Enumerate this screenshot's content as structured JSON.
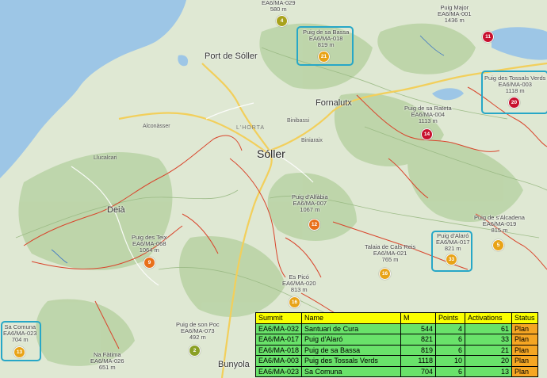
{
  "map": {
    "towns": [
      {
        "name": "Port de Sóller",
        "id": "port-de-soller"
      },
      {
        "name": "Fornalutx",
        "id": "fornalutx"
      },
      {
        "name": "Sóller",
        "id": "soller"
      },
      {
        "name": "Deià",
        "id": "deia"
      },
      {
        "name": "Bunyola",
        "id": "bunyola"
      }
    ],
    "small_places": [
      {
        "name": "Alconàsser",
        "id": "alconasser"
      },
      {
        "name": "Llucalcari",
        "id": "llucalcari"
      },
      {
        "name": "Biniaraix",
        "id": "biniaraix"
      },
      {
        "name": "Binibassi",
        "id": "binibassi"
      },
      {
        "name": "L'HORTA",
        "id": "lhorta"
      }
    ],
    "peaks": [
      {
        "id": "ma-029",
        "lines": [
          "EA6/MA-029",
          "580 m"
        ],
        "marker": "4",
        "color": "#a8a21c"
      },
      {
        "id": "puig-major",
        "lines": [
          "Puig Major",
          "EA6/MA-001",
          "1436 m"
        ],
        "marker": "11",
        "color": "#c8102e"
      },
      {
        "id": "puig-de-sa-bassa",
        "lines": [
          "Puig de sa Bassa",
          "EA6/MA-018",
          "819 m"
        ],
        "marker": "21",
        "color": "#e8a317"
      },
      {
        "id": "puig-des-tossals-verds",
        "lines": [
          "Puig des Tossals Verds",
          "EA6/MA-003",
          "1118 m"
        ],
        "marker": "20",
        "color": "#c8102e"
      },
      {
        "id": "puig-de-sa-rateta",
        "lines": [
          "Puig de sa Rateta",
          "EA6/MA-004",
          "1113 m"
        ],
        "marker": "14",
        "color": "#c8102e"
      },
      {
        "id": "puig-dalfabia",
        "lines": [
          "Puig d'Alfàbia",
          "EA6/MA-007",
          "1067 m"
        ],
        "marker": "12",
        "color": "#e8701a"
      },
      {
        "id": "puig-de-s-alcadena",
        "lines": [
          "Puig de s'Alcadena",
          "EA6/MA-019",
          "815 m"
        ],
        "marker": "5",
        "color": "#e8a317"
      },
      {
        "id": "puig-des-teix",
        "lines": [
          "Puig des Teix",
          "EA6/MA-068",
          "1064 m"
        ],
        "marker": "9",
        "color": "#e8701a"
      },
      {
        "id": "talaia-de-cals-reis",
        "lines": [
          "Talaia de Cals Reis",
          "EA6/MA-021",
          "765 m"
        ],
        "marker": "16",
        "color": "#e8a317"
      },
      {
        "id": "puig-dalaro",
        "lines": [
          "Puig d'Alaró",
          "EA6/MA-017",
          "821 m"
        ],
        "marker": "33",
        "color": "#e8a317"
      },
      {
        "id": "es-pico",
        "lines": [
          "Es Picó",
          "EA6/MA-020",
          "813 m"
        ],
        "marker": "16",
        "color": "#e8a317"
      },
      {
        "id": "puig-de-son-poc",
        "lines": [
          "Puig de son Poc",
          "EA6/MA-073",
          "492 m"
        ],
        "marker": "2",
        "color": "#8aa024"
      },
      {
        "id": "sa-comuna",
        "lines": [
          "Sa Comuna",
          "EA6/MA-023",
          "704 m"
        ],
        "marker": "13",
        "color": "#e8a317"
      },
      {
        "id": "na-fatima",
        "lines": [
          "Na Fàtima",
          "EA6/MA-026",
          "651 m"
        ],
        "marker": "",
        "color": ""
      }
    ]
  },
  "table": {
    "headers": [
      "Summit",
      "Name",
      "M",
      "Points",
      "Activations",
      "Status"
    ],
    "rows": [
      [
        "EA6/MA-032",
        "Santuari de Cura",
        "544",
        "4",
        "61",
        "Plan"
      ],
      [
        "EA6/MA-017",
        "Puig d'Alaró",
        "821",
        "6",
        "33",
        "Plan"
      ],
      [
        "EA6/MA-018",
        "Puig de sa Bassa",
        "819",
        "6",
        "21",
        "Plan"
      ],
      [
        "EA6/MA-003",
        "Puig des Tossals Verds",
        "1118",
        "10",
        "20",
        "Plan"
      ],
      [
        "EA6/MA-023",
        "Sa Comuna",
        "704",
        "6",
        "13",
        "Plan"
      ]
    ]
  },
  "colors": {
    "sea": "#9dc6e6",
    "land": "#dfe8d3",
    "highlight": "#27a7c7",
    "header_yellow": "#fbff00",
    "row_green": "#69e26a",
    "status_orange": "#f5a623"
  }
}
